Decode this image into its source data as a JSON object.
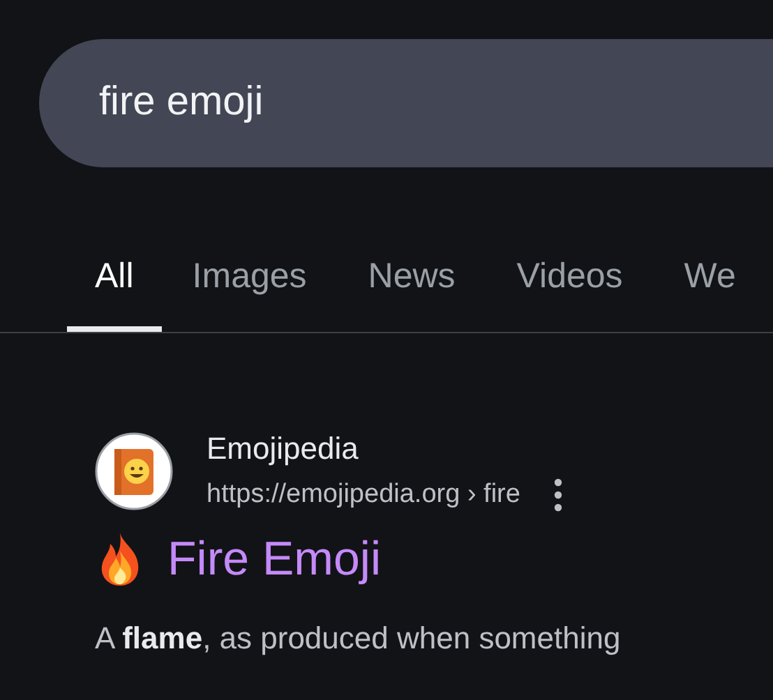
{
  "search": {
    "value": "fire emoji"
  },
  "tabs": [
    {
      "label": "All",
      "selected": true
    },
    {
      "label": "Images",
      "selected": false
    },
    {
      "label": "News",
      "selected": false
    },
    {
      "label": "Videos",
      "selected": false
    },
    {
      "label": "We",
      "selected": false
    }
  ],
  "results": [
    {
      "site": "Emojipedia",
      "url": "https://emojipedia.org › fire",
      "title": "Fire Emoji",
      "snippet": "A **flame**, as produced when something"
    }
  ]
}
